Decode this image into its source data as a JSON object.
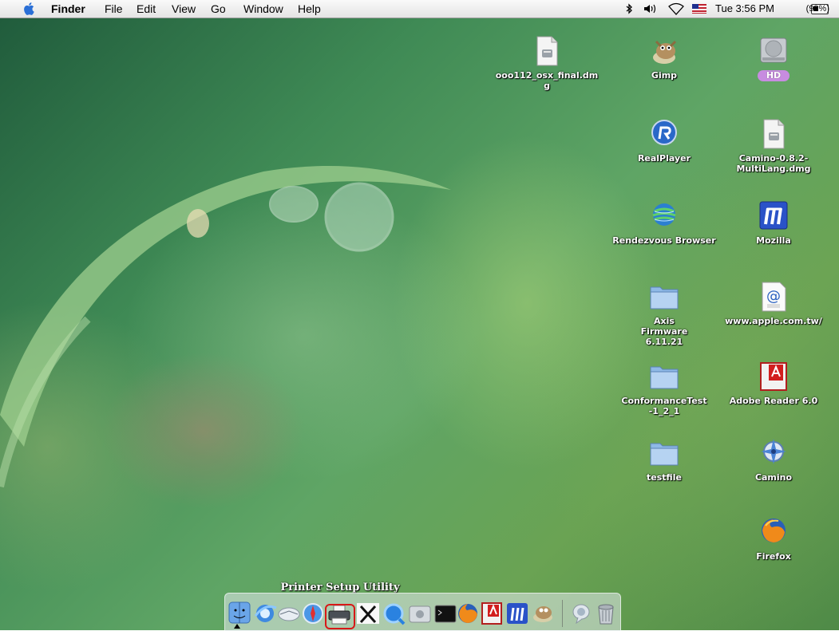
{
  "menubar": {
    "app": "Finder",
    "menus": [
      "File",
      "Edit",
      "View",
      "Go",
      "Window",
      "Help"
    ],
    "clock": "Tue 3:56 PM",
    "battery": "(99%)",
    "icons": [
      "bluetooth-icon",
      "volume-icon",
      "airport-wifi-icon",
      "us-flag-input-icon",
      "battery-icon"
    ]
  },
  "desktop": {
    "icons": [
      {
        "label": "ooo112_osx_final.dmg",
        "icon": "disk-image-icon"
      },
      {
        "label": "Gimp",
        "icon": "gimp-icon"
      },
      {
        "label": "HD",
        "icon": "hard-drive-icon"
      },
      {
        "label": "RealPlayer",
        "icon": "realplayer-icon"
      },
      {
        "label": "Camino-0.8.2-MultiLang.dmg",
        "icon": "disk-image-icon"
      },
      {
        "label": "Rendezvous Browser",
        "icon": "globe-icon"
      },
      {
        "label": "Mozilla",
        "icon": "mozilla-icon"
      },
      {
        "label": "Axis Firmware 6.11.21",
        "icon": "folder-icon"
      },
      {
        "label": "www.apple.com.tw/",
        "icon": "web-location-icon"
      },
      {
        "label": "ConformanceTest -1_2_1",
        "icon": "folder-icon"
      },
      {
        "label": "Adobe Reader 6.0",
        "icon": "adobe-reader-icon"
      },
      {
        "label": "testfile",
        "icon": "folder-icon"
      },
      {
        "label": "Camino",
        "icon": "camino-icon"
      },
      {
        "label": "Firefox",
        "icon": "firefox-icon"
      }
    ]
  },
  "dock": {
    "tooltip": "Printer Setup Utility",
    "items": [
      "finder-icon",
      "internet-explorer-icon",
      "mail-icon",
      "safari-icon",
      "printer-setup-utility-icon",
      "x11-icon",
      "quicktime-icon",
      "system-preferences-icon",
      "terminal-icon",
      "firefox-icon",
      "adobe-reader-icon",
      "mozilla-icon",
      "gimp-icon",
      "ichat-icon",
      "trash-icon"
    ]
  },
  "colors": {
    "highlight": "#d81818",
    "hd_badge": "#c78ce0"
  }
}
